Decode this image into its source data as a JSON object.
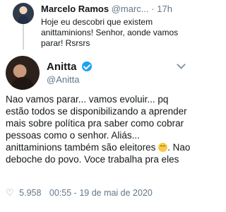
{
  "reply": {
    "name": "Marcelo Ramos",
    "handle": "@marc...",
    "dot": "·",
    "time": "17h",
    "text": "Hoje eu descobri que existem anittaminions! Senhor, aonde vamos parar! Rsrsrs"
  },
  "main": {
    "name": "Anitta",
    "handle": "@Anitta",
    "text_part1": "Nao vamos parar... vamos evoluir... pq estão todos se disponibilizando a aprender mais sobre política pra saber como cobrar pessoas como o senhor. Aliás... anittaminions também são eleitores ",
    "text_part2": ". Nao deboche do povo. Voce trabalha pra eles",
    "likes": "5.958",
    "time": "00:55",
    "date": "19 de mai de 2020"
  }
}
